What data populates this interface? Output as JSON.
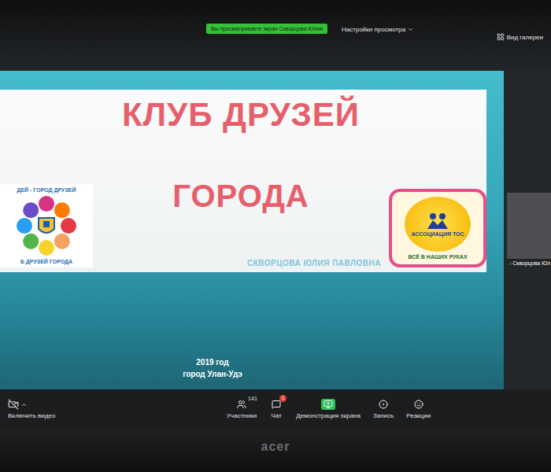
{
  "meeting": {
    "share_banner": "Вы просматриваете экран Скворцова Юлия",
    "view_options": "Настройки просмотра",
    "gallery_view": "Вид галереи"
  },
  "slide": {
    "title_line1": "КЛУБ ДРУЗЕЙ",
    "title_line2": "ГОРОДА",
    "author": "СКВОРЦОВА ЮЛИЯ ПАВЛОВНА",
    "year": "2019 год",
    "city": "город Улан-Удэ",
    "left_logo": {
      "top_text": "ДЕЙ - ГОРОД ДРУЗЕЙ",
      "bottom_text": "Б ДРУЗЕЙ ГОРОДА"
    },
    "right_logo": {
      "name": "АССОЦИАЦИЯ ТОС",
      "motto": "ВСЁ В НАШИХ РУКАХ"
    }
  },
  "participant_tile": {
    "name": "Скворцова Юл"
  },
  "toolbar": {
    "video": {
      "label": "Включить видео"
    },
    "items": [
      {
        "kind": "participants",
        "label": "Участники",
        "badge": "141",
        "active": false
      },
      {
        "kind": "chat",
        "label": "Чат",
        "badge": "1",
        "active": false
      },
      {
        "kind": "share",
        "label": "Демонстрация экрана",
        "badge": "",
        "active": true
      },
      {
        "kind": "record",
        "label": "Запись",
        "badge": "",
        "active": false
      },
      {
        "kind": "reactions",
        "label": "Реакции",
        "badge": "",
        "active": false
      }
    ]
  },
  "laptop": {
    "brand": "acer"
  }
}
